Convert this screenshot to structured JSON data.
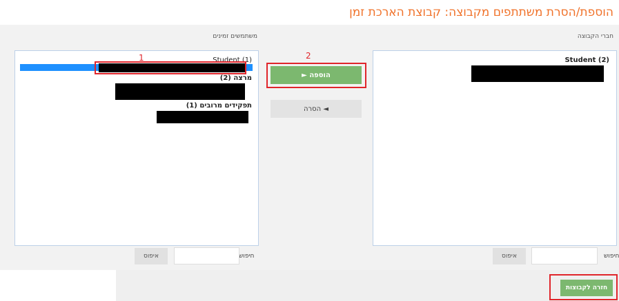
{
  "page": {
    "title": "הוספת/הסרת משתתפים מקבוצה: קבוצת הארכת זמן"
  },
  "members": {
    "label": "חברי הקבוצה",
    "groups": [
      {
        "label": "Student (2)"
      }
    ],
    "search_label": "חיפוש",
    "search_value": "",
    "reset_label": "איפוס"
  },
  "available": {
    "label": "משתמשים זמינים",
    "groups": [
      {
        "label": "Student (1)"
      },
      {
        "label": "מרצה (2)"
      },
      {
        "label": "תפקידים מרובים (1)"
      }
    ],
    "search_label": "חיפוש",
    "search_value": "",
    "reset_label": "איפוס"
  },
  "actions": {
    "add_label": "► הוספה",
    "remove_label": "הסרה ◄",
    "back_label": "חזרה לקבוצות"
  },
  "annotations": {
    "marker1": "1",
    "marker2": "2"
  },
  "colors": {
    "title": "#f0722a",
    "add_button": "#7cb86f",
    "highlight": "#e0242a",
    "selection": "#1e90ff"
  }
}
